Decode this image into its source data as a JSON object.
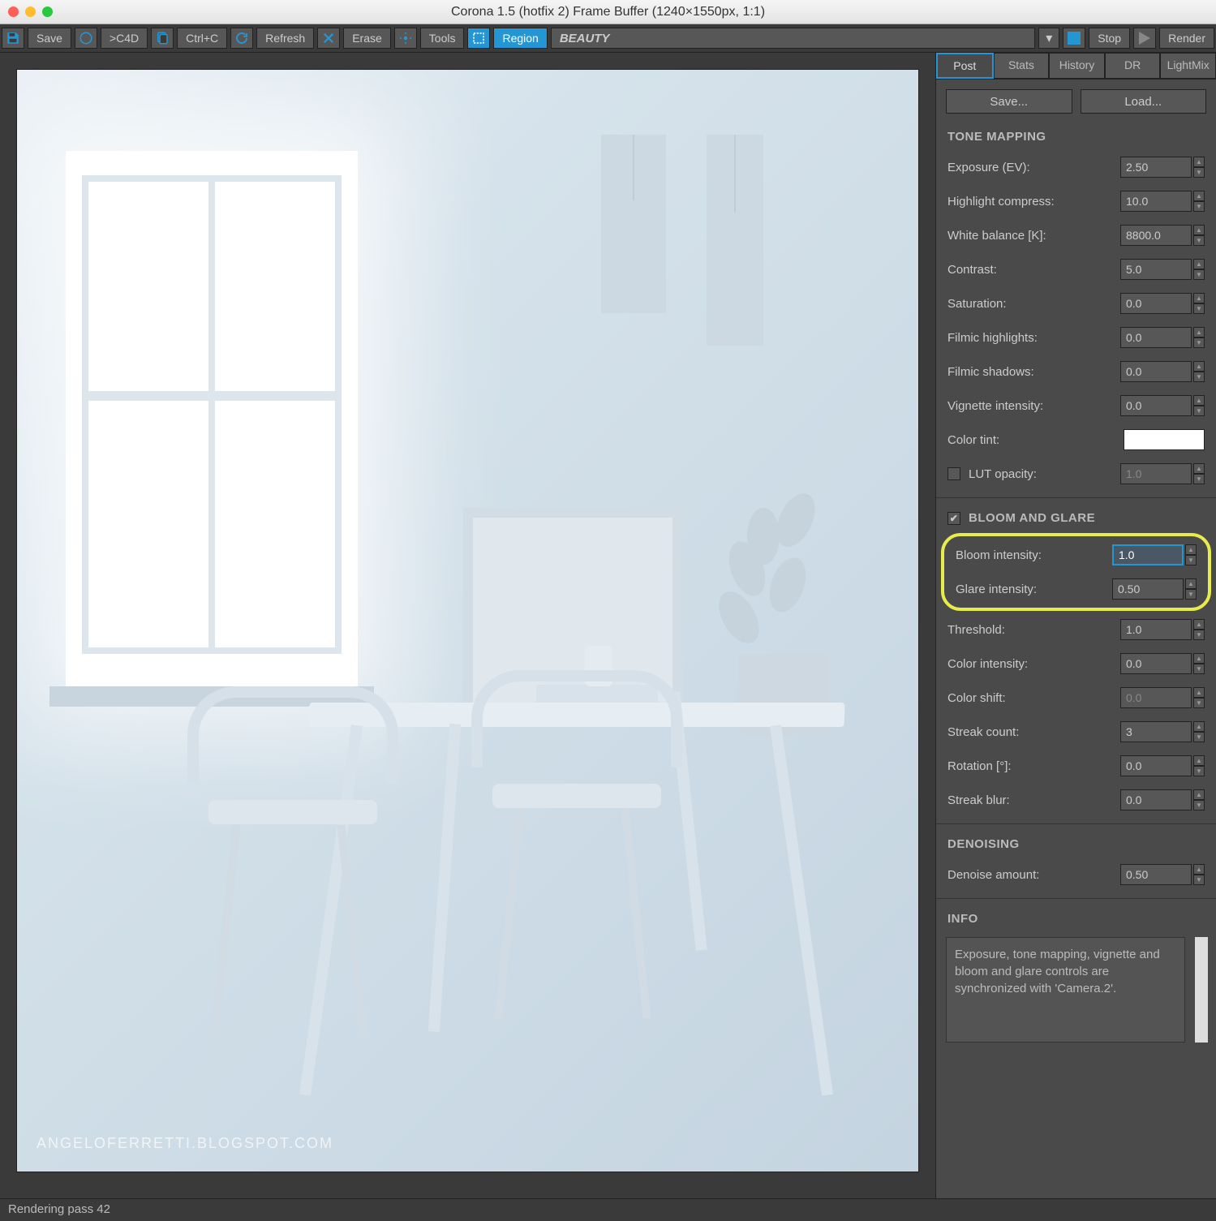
{
  "window_title": "Corona 1.5 (hotfix 2) Frame Buffer (1240×1550px, 1:1)",
  "toolbar": {
    "save": "Save",
    "c4d": ">C4D",
    "ctrlc": "Ctrl+C",
    "refresh": "Refresh",
    "erase": "Erase",
    "tools": "Tools",
    "region": "Region",
    "beauty": "BEAUTY",
    "stop": "Stop",
    "render": "Render"
  },
  "tabs": [
    "Post",
    "Stats",
    "History",
    "DR",
    "LightMix"
  ],
  "buttons": {
    "save": "Save...",
    "load": "Load..."
  },
  "sections": {
    "tone": "TONE MAPPING",
    "bloom": "BLOOM AND GLARE",
    "denoise": "DENOISING",
    "info": "INFO"
  },
  "tone": {
    "exposure_l": "Exposure (EV):",
    "exposure_v": "2.50",
    "highlight_l": "Highlight compress:",
    "highlight_v": "10.0",
    "wb_l": "White balance [K]:",
    "wb_v": "8800.0",
    "contrast_l": "Contrast:",
    "contrast_v": "5.0",
    "saturation_l": "Saturation:",
    "saturation_v": "0.0",
    "fhigh_l": "Filmic highlights:",
    "fhigh_v": "0.0",
    "fshad_l": "Filmic shadows:",
    "fshad_v": "0.0",
    "vign_l": "Vignette intensity:",
    "vign_v": "0.0",
    "tint_l": "Color tint:",
    "lut_l": "LUT opacity:",
    "lut_v": "1.0"
  },
  "bloom": {
    "bi_l": "Bloom intensity:",
    "bi_v": "1.0",
    "gi_l": "Glare intensity:",
    "gi_v": "0.50",
    "th_l": "Threshold:",
    "th_v": "1.0",
    "ci_l": "Color intensity:",
    "ci_v": "0.0",
    "cs_l": "Color shift:",
    "cs_v": "0.0",
    "sc_l": "Streak count:",
    "sc_v": "3",
    "rot_l": "Rotation [°]:",
    "rot_v": "0.0",
    "sb_l": "Streak blur:",
    "sb_v": "0.0"
  },
  "denoise": {
    "da_l": "Denoise amount:",
    "da_v": "0.50"
  },
  "info_text": "Exposure, tone mapping, vignette and bloom and glare controls are synchronized with 'Camera.2'.",
  "watermark": "ANGELOFERRETTI.BLOGSPOT.COM",
  "status": "Rendering pass 42"
}
